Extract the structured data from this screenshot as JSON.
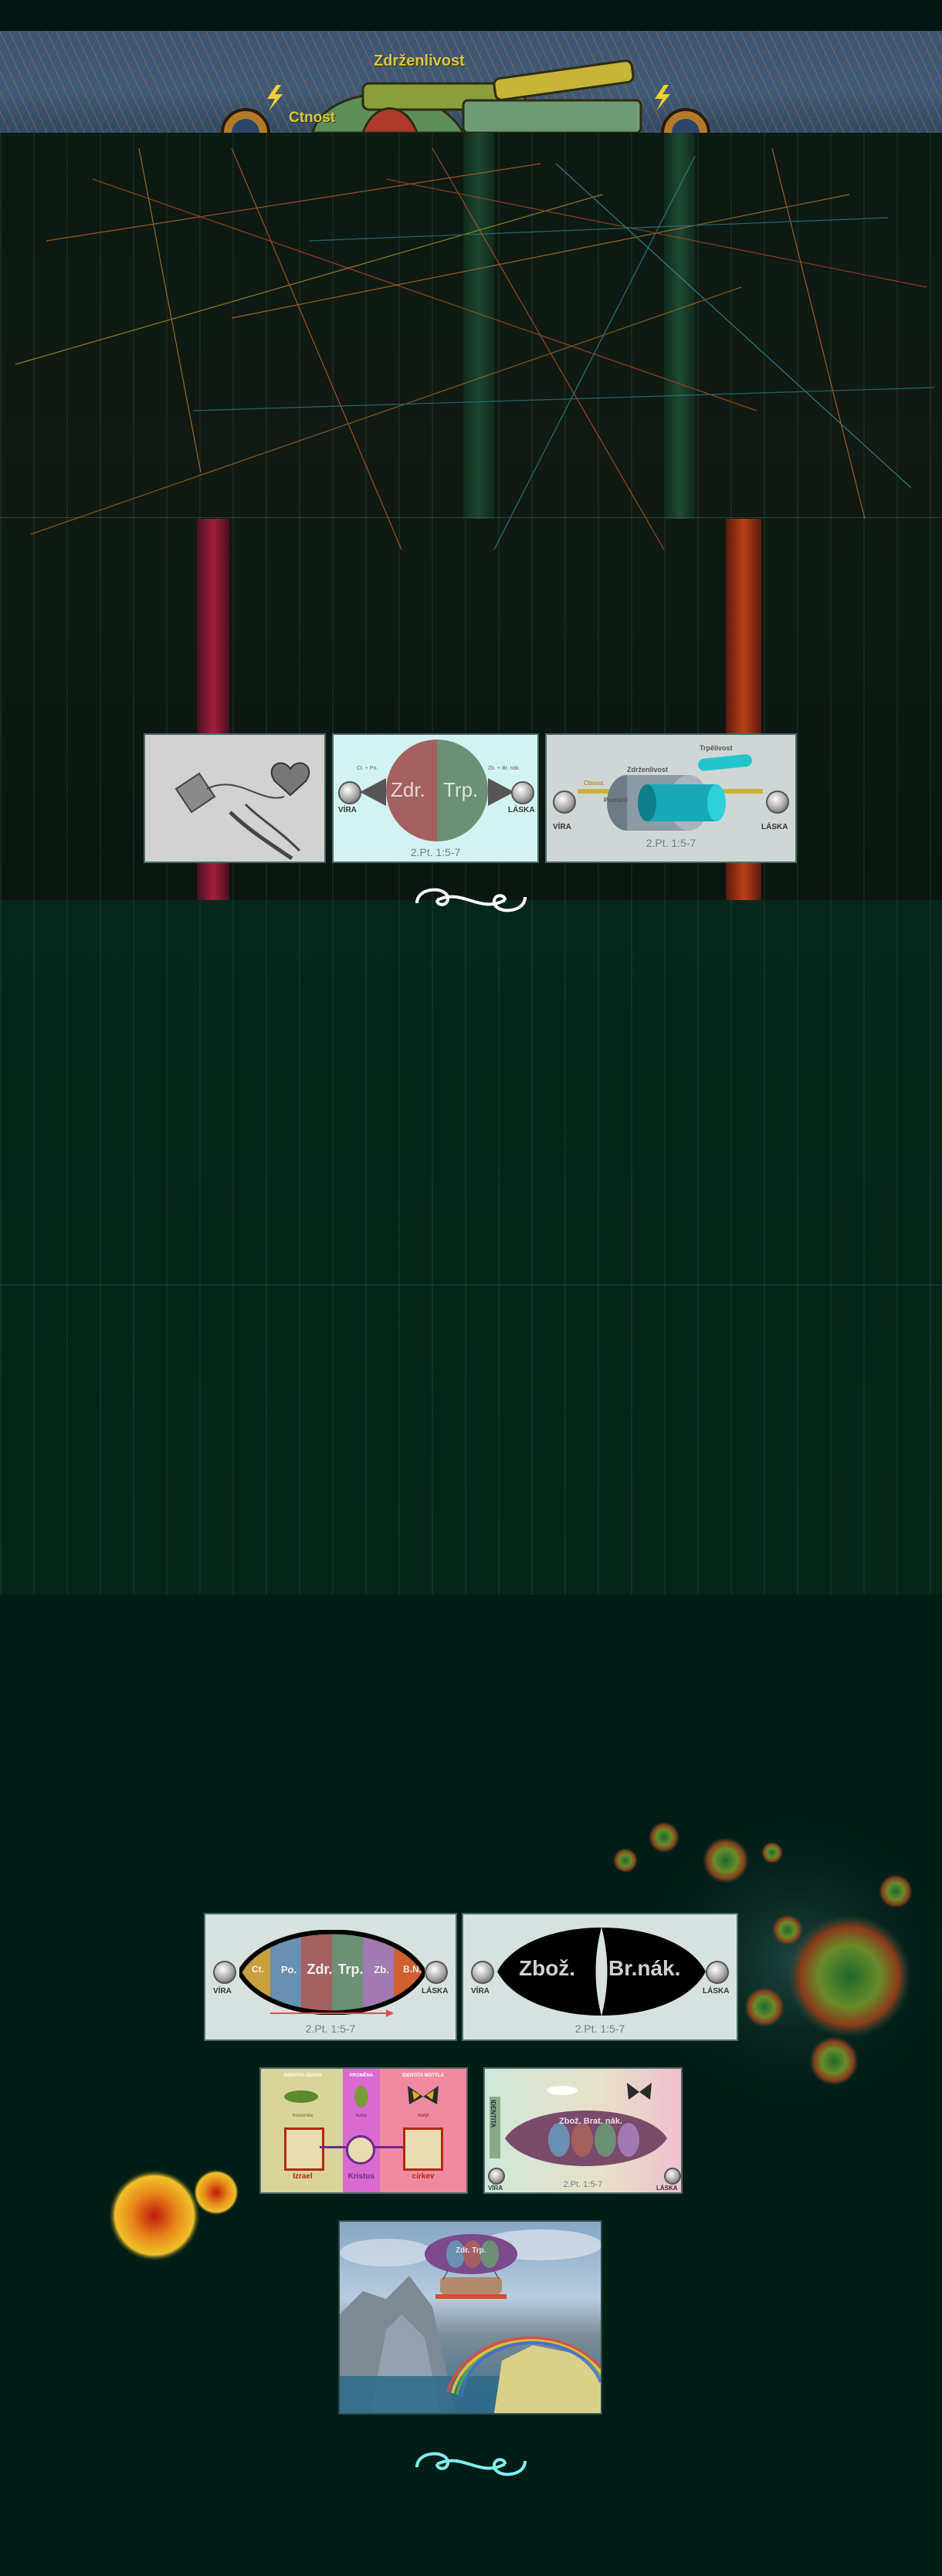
{
  "banner": {
    "word_top": "Zdrženlivost",
    "word_left": "Ctnost"
  },
  "panels": {
    "two_lobes": {
      "left_text": "Zdr.",
      "right_text": "Trp.",
      "small_left": "Ct. + Po.",
      "small_right": "Zb. + Br. nák.",
      "label_left": "VÍRA",
      "label_right": "LÁSKA",
      "caption": "2.Pt. 1:5-7"
    },
    "cylinder": {
      "label_top": "Trpělivost",
      "label_mid": "Zdrženlivost",
      "label_small1": "Ctnost",
      "label_small2": "Poznání",
      "label_left": "VÍRA",
      "label_right": "LÁSKA",
      "caption": "2.Pt. 1:5-7"
    },
    "rainbow_lens": {
      "segments": [
        "Ct.",
        "Po.",
        "Zdr.",
        "Trp.",
        "Zb.",
        "B.N."
      ],
      "label_left": "VÍRA",
      "label_right": "LÁSKA",
      "caption": "2.Pt. 1:5-7"
    },
    "black_lens": {
      "left_text": "Zbož.",
      "right_text": "Br.nák.",
      "label_left": "VÍRA",
      "label_right": "LÁSKA",
      "caption": "2.Pt. 1:5-7"
    },
    "identity_chart": {
      "col1_head": "IDENTITA ČERVA",
      "col2_head": "PROMĚNA",
      "col3_head": "IDENTITA MOTÝLA",
      "word1": "housenka",
      "word2": "kukla",
      "word3": "motýl",
      "bottom1": "Izrael",
      "bottom2": "Kristus",
      "bottom3": "církev"
    },
    "identity_lens": {
      "side_label": "IDENTITA",
      "inner_text": "Zbož. Brat. nák.",
      "label_left": "VÍRA",
      "label_right": "LÁSKA",
      "caption": "2.Pt. 1:5-7"
    },
    "airship_scene": {
      "badge": "Zdr. Trp."
    }
  },
  "colors": {
    "page_bg": "#021d15",
    "banner_bg": "#3a5575",
    "banner_text": "#d8c640",
    "panel_light": "#d7e2e0",
    "panel_cyan": "#d3f3f2",
    "rose": "#a46060",
    "sage": "#6c8f75",
    "swirl": "#7ff0f0"
  },
  "icons": {
    "divider_top": "ornament-swirl-icon",
    "divider_bottom": "ornament-swirl-icon",
    "orb": "silver-orb-icon"
  }
}
